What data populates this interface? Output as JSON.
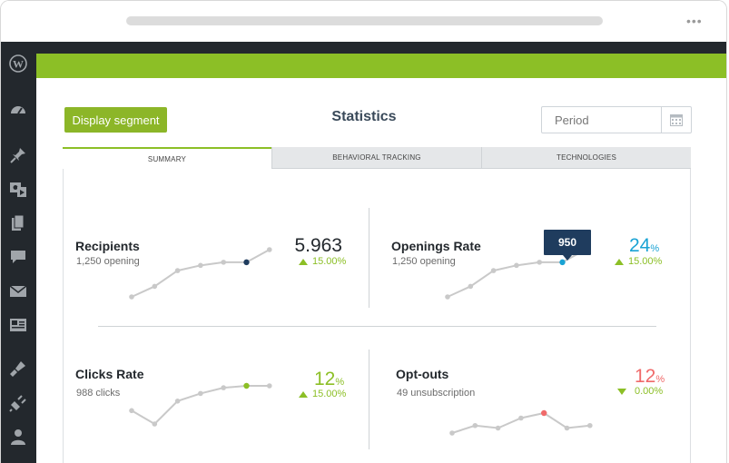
{
  "browser": {
    "menu_icon": "more-dots-icon",
    "menu_glyph": "•••"
  },
  "sidebar": {
    "items": [
      {
        "icon": "wordpress-icon"
      },
      {
        "icon": "dashboard-icon"
      },
      {
        "icon": "pin-icon"
      },
      {
        "icon": "media-icon"
      },
      {
        "icon": "pages-icon"
      },
      {
        "icon": "comments-icon"
      },
      {
        "icon": "mail-icon"
      },
      {
        "icon": "layout-icon"
      },
      {
        "icon": "appearance-icon"
      },
      {
        "icon": "plugins-icon"
      },
      {
        "icon": "users-icon"
      }
    ]
  },
  "toolbar": {
    "segment_button": "Display segment",
    "title": "Statistics",
    "period_placeholder": "Period"
  },
  "tabs": [
    {
      "label": "SUMMARY",
      "active": true
    },
    {
      "label": "BEHAVIORAL TRACKING",
      "active": false
    },
    {
      "label": "TECHNOLOGIES",
      "active": false
    }
  ],
  "stats": {
    "recipients": {
      "title": "Recipients",
      "subtitle": "1,250 opening",
      "value": "5.963",
      "delta": "15.00%",
      "trend": "up",
      "series": [
        2,
        3,
        4.5,
        5,
        5.3,
        5.3,
        6.5
      ],
      "highlight_index": 5,
      "highlight_color": "#1f3c5e"
    },
    "openings": {
      "title": "Openings Rate",
      "subtitle": "1,250 opening",
      "value": "24",
      "unit": "%",
      "delta": "15.00%",
      "trend": "up",
      "series": [
        2,
        3,
        4.5,
        5,
        5.3,
        5.3,
        6.5
      ],
      "highlight_index": 5,
      "highlight_color": "#1aa3d4",
      "tooltip": "950"
    },
    "clicks": {
      "title": "Clicks Rate",
      "subtitle": "988 clicks",
      "value": "12",
      "unit": "%",
      "delta": "15.00%",
      "trend": "up",
      "series": [
        3.5,
        2.8,
        4,
        4.4,
        4.7,
        4.8,
        4.8
      ],
      "highlight_index": 5,
      "highlight_color": "#8cbf26"
    },
    "optouts": {
      "title": "Opt-outs",
      "subtitle": "49 unsubscription",
      "value": "12",
      "unit": "%",
      "delta": "0.00%",
      "trend": "down",
      "series": [
        3,
        3.3,
        3.2,
        3.6,
        3.8,
        3.2,
        3.3
      ],
      "highlight_index": 4,
      "highlight_color": "#f06a6a"
    }
  },
  "colors": {
    "green": "#8cbf26",
    "navy": "#1f3c5e",
    "blue": "#1aa3d4",
    "red": "#f06a6a",
    "sidebar": "#23282d"
  }
}
